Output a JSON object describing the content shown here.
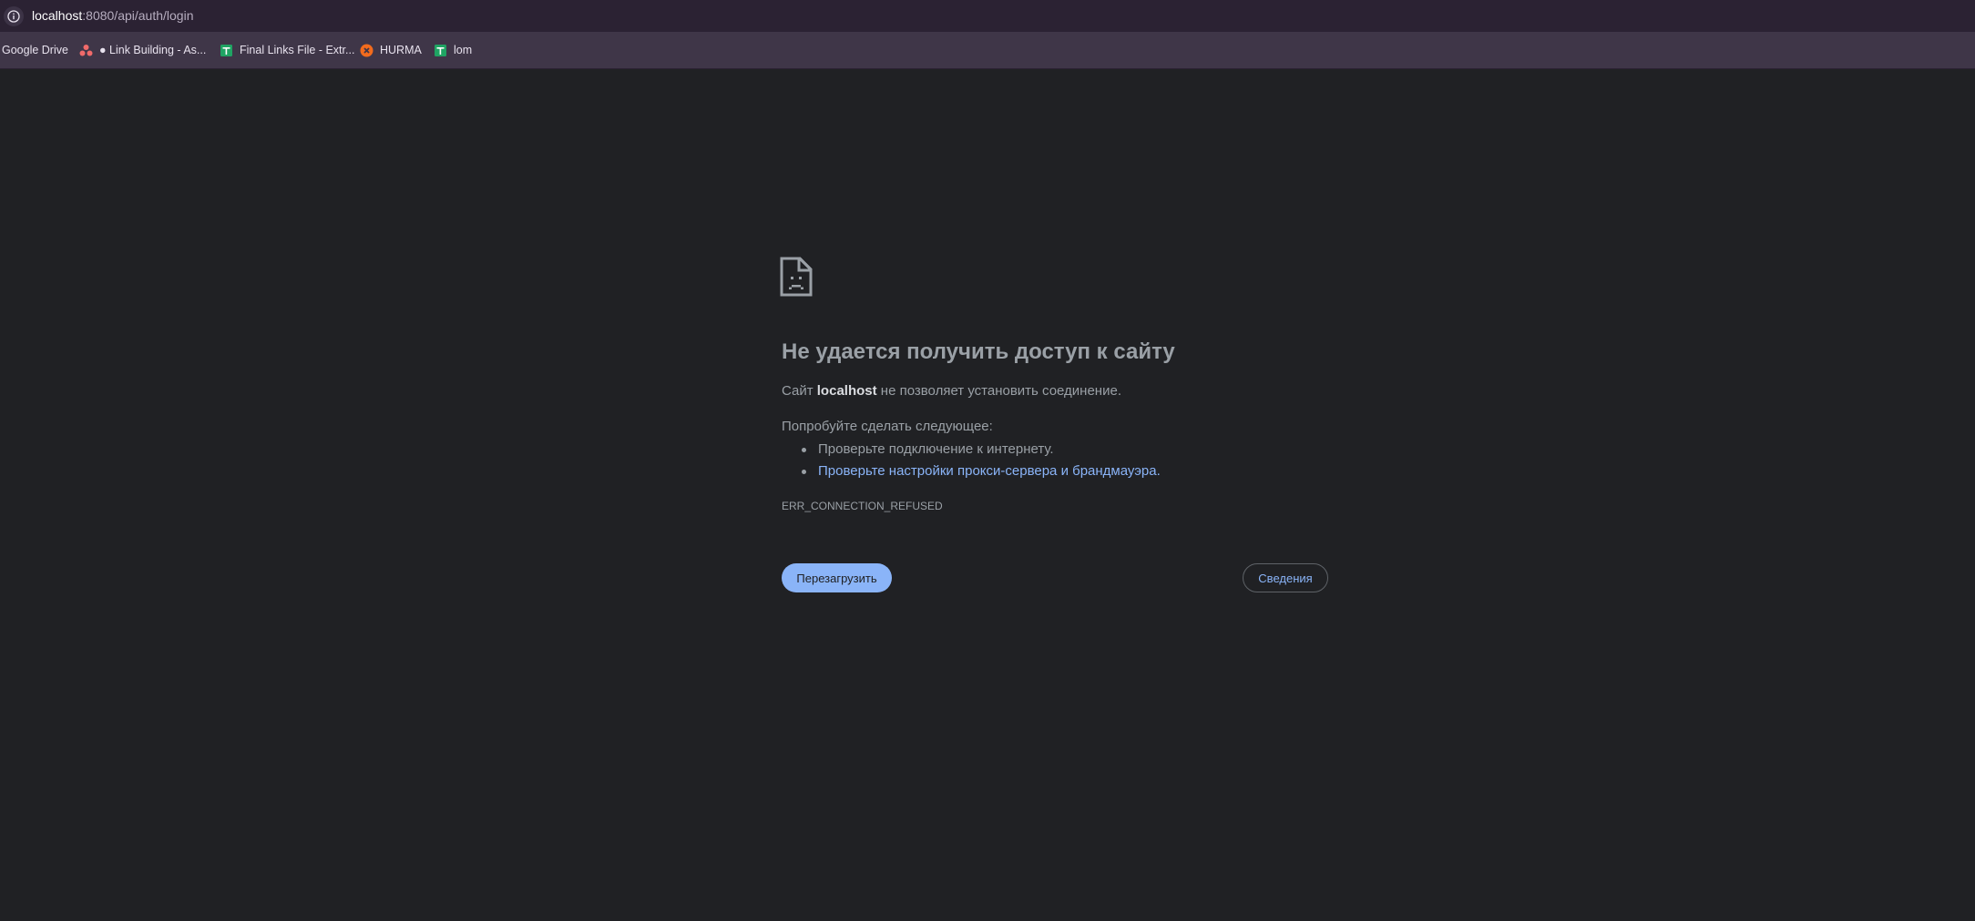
{
  "browser": {
    "url_host": "localhost",
    "url_rest": ":8080/api/auth/login",
    "bookmarks": [
      {
        "label": "Google Drive",
        "icon": "none"
      },
      {
        "label": "● Link Building - As...",
        "icon": "asana-icon"
      },
      {
        "label": "Final Links File - Extr...",
        "icon": "google-sheets-icon"
      },
      {
        "label": "HURMA",
        "icon": "hurma-icon"
      },
      {
        "label": "lom",
        "icon": "google-sheets-icon"
      }
    ]
  },
  "error_page": {
    "icon": "sad-document-icon",
    "title": "Не удается получить доступ к сайту",
    "site_prefix": "Сайт ",
    "site_name": "localhost",
    "site_suffix": " не позволяет установить соединение.",
    "try_heading": "Попробуйте сделать следующее:",
    "suggestions": [
      "Проверьте подключение к интернету.",
      "Проверьте настройки прокси-сервера и брандмауэра."
    ],
    "error_code": "ERR_CONNECTION_REFUSED",
    "reload_button": "Перезагрузить",
    "details_button": "Сведения"
  },
  "colors": {
    "background": "#202124",
    "text": "#9aa0a6",
    "link": "#8ab4f8",
    "button_primary": "#8ab4f8",
    "address_bar": "#2b2233",
    "bookmarks_bar": "#3f3648"
  }
}
